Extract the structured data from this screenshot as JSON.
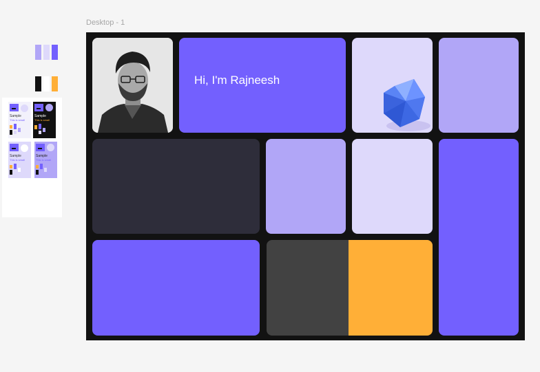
{
  "frame": {
    "label": "Desktop - 1"
  },
  "hero": {
    "greeting": "Hi, I'm Rajneesh"
  },
  "style_panel": {
    "thumbnails": [
      {
        "title": "Sample",
        "subtitle": "This is small"
      },
      {
        "title": "Sample",
        "subtitle": "This is small"
      },
      {
        "title": "Sample",
        "subtitle": "This is small"
      },
      {
        "title": "Sample",
        "subtitle": "This is small"
      }
    ]
  },
  "colors": {
    "canvas": "#f5f5f5",
    "frame_bg": "#121212",
    "violet": "#7360fe",
    "lavender": "#b1a6f7",
    "pale_lavender": "#ded9fb",
    "charcoal": "#2e2d3a",
    "dark_grey": "#424242",
    "orange": "#ffaf37",
    "black": "#111111"
  },
  "icons": {
    "avatar": "portrait-photo",
    "hero_graphic": "icosahedron-gem-icon"
  }
}
